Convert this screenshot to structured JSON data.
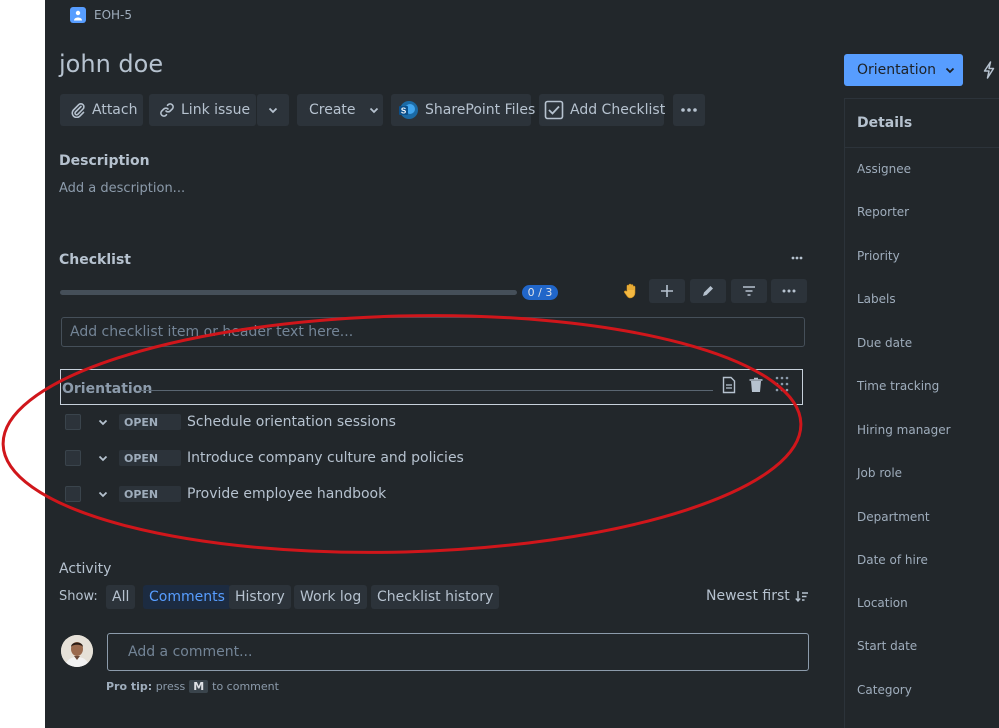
{
  "issue": {
    "key": "EOH-5",
    "title": "john doe"
  },
  "toolbar": {
    "attach": "Attach",
    "link_issue": "Link issue",
    "create": "Create",
    "sharepoint": "SharePoint Files",
    "add_checklist": "Add Checklist"
  },
  "description": {
    "label": "Description",
    "placeholder": "Add a description..."
  },
  "checklist": {
    "label": "Checklist",
    "progress_text": "0 / 3",
    "progress_fraction": 0,
    "input_placeholder": "Add checklist item or header text here...",
    "header": "Orientation",
    "items": [
      {
        "status": "OPEN",
        "text": "Schedule orientation sessions"
      },
      {
        "status": "OPEN",
        "text": "Introduce company culture and policies"
      },
      {
        "status": "OPEN",
        "text": "Provide employee handbook"
      }
    ]
  },
  "activity": {
    "label": "Activity",
    "show_label": "Show:",
    "filters": [
      "All",
      "Comments",
      "History",
      "Work log",
      "Checklist history"
    ],
    "active_filter": "Comments",
    "sort": "Newest first",
    "comment_placeholder": "Add a comment...",
    "protip_bold": "Pro tip:",
    "protip_press": "press",
    "protip_key": "M",
    "protip_after": "to comment"
  },
  "sidebar": {
    "status_button": "Orientation",
    "details_title": "Details",
    "fields": [
      "Assignee",
      "Reporter",
      "Priority",
      "Labels",
      "Due date",
      "Time tracking",
      "Hiring manager",
      "Job role",
      "Department",
      "Date of hire",
      "Location",
      "Start date",
      "Category"
    ]
  },
  "colors": {
    "background": "#22272b",
    "accent": "#579dff",
    "annotation_ellipse": "#d0161b"
  },
  "icons": [
    "user-icon",
    "paperclip-icon",
    "link-icon",
    "chevron-down-icon",
    "sharepoint-icon",
    "checkbox-icon",
    "more-icon",
    "hand-icon",
    "plus-icon",
    "pencil-icon",
    "filter-icon",
    "document-icon",
    "trash-icon",
    "drag-grid-icon",
    "sort-icon",
    "lightning-icon"
  ]
}
